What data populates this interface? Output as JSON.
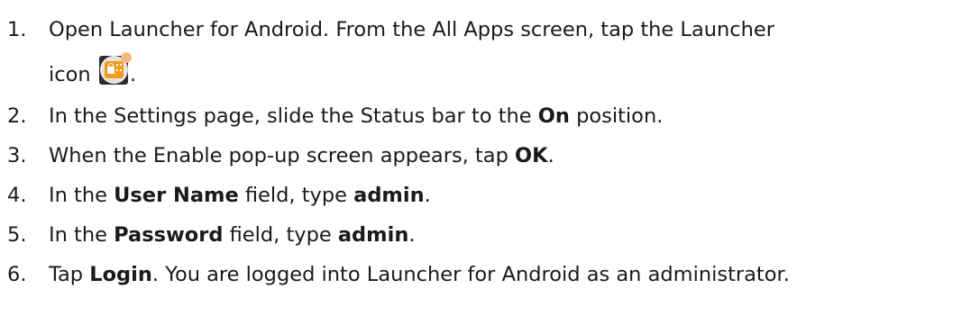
{
  "steps": [
    {
      "number": "1.",
      "text_a": "Open Launcher for Android. From the All Apps screen, tap the Launcher",
      "text_b": "icon",
      "text_c": ".",
      "icon": "launcher-app-icon"
    },
    {
      "number": "2.",
      "text_a": "In the Settings page, slide the Status bar to the ",
      "bold_a": "On",
      "text_b": " position."
    },
    {
      "number": "3.",
      "text_a": "When the Enable pop-up screen appears, tap ",
      "bold_a": "OK",
      "text_b": "."
    },
    {
      "number": "4.",
      "text_a": "In the ",
      "bold_a": "User Name",
      "text_b": " field, type ",
      "bold_b": "admin",
      "text_c": "."
    },
    {
      "number": "5.",
      "text_a": "In the ",
      "bold_a": "Password",
      "text_b": " field, type ",
      "bold_b": "admin",
      "text_c": "."
    },
    {
      "number": "6.",
      "text_a": "Tap ",
      "bold_a": "Login",
      "text_b": ". You are logged into Launcher for Android as an administrator."
    }
  ],
  "colors": {
    "text": "#1a1a1a",
    "icon_orange": "#f29a1e",
    "icon_badge": "#f5b97c"
  }
}
